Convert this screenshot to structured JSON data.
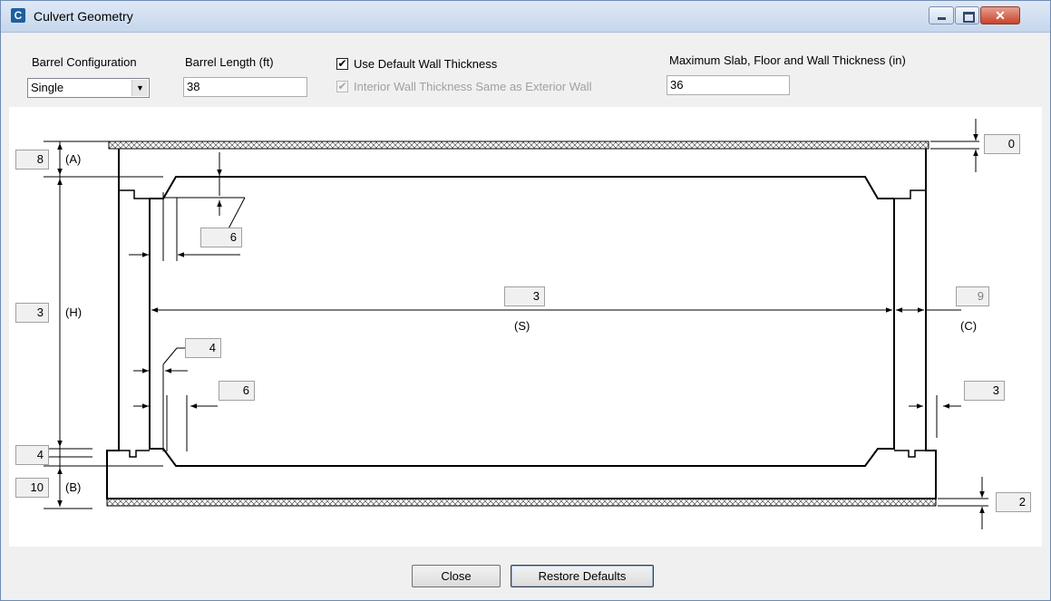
{
  "window": {
    "title": "Culvert Geometry",
    "icon": "culvert-app-icon",
    "close_glyph": "✕"
  },
  "barrel_configuration": {
    "label": "Barrel Configuration",
    "value": "Single",
    "arrow": "▼"
  },
  "barrel_length": {
    "label": "Barrel Length (ft)",
    "value": "38"
  },
  "use_default_wall": {
    "label": "Use Default Wall Thickness",
    "checked": true,
    "mark": "✔"
  },
  "interior_wall_same": {
    "label": "Interior Wall Thickness Same as Exterior Wall",
    "checked": true,
    "enabled": false,
    "mark": "✔"
  },
  "max_thickness": {
    "label": "Maximum Slab, Floor and Wall Thickness (in)",
    "value": "36"
  },
  "dimensions": {
    "top_slab": {
      "value": "8",
      "label": "(A)"
    },
    "height": {
      "value": "3",
      "label": "(H)"
    },
    "bottom_haunch": {
      "value": "4"
    },
    "bottom_slab": {
      "value": "10",
      "label": "(B)"
    },
    "top_haunch_vertical": {
      "value": "6"
    },
    "span": {
      "value": "3",
      "label": "(S)"
    },
    "exterior_wall": {
      "value": "9",
      "label": "(C)"
    },
    "top_fill": {
      "value": "0"
    },
    "interior_haunch": {
      "value": "4"
    },
    "bottom_haunch_horizontal": {
      "value": "6"
    },
    "right_offset": {
      "value": "3"
    },
    "bottom_fill": {
      "value": "2"
    }
  },
  "buttons": {
    "close": "Close",
    "restore_defaults": "Restore Defaults"
  }
}
